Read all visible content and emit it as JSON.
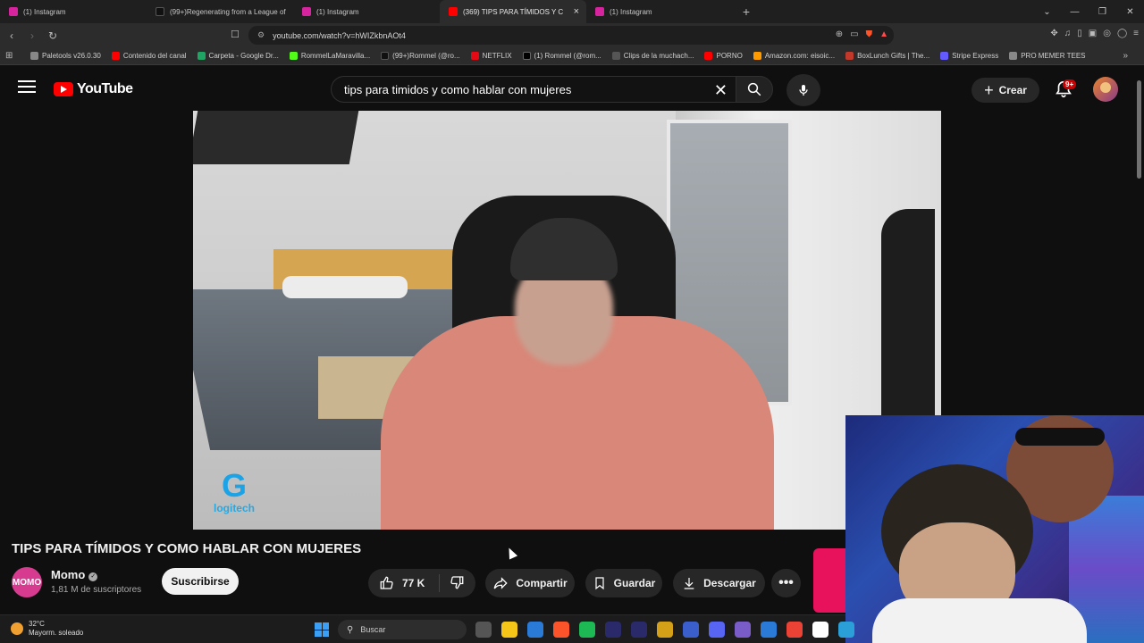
{
  "browser": {
    "tabs": [
      {
        "label": "(1) Instagram",
        "color": "#d6249f",
        "active": false
      },
      {
        "label": "(99+)Regenerating from a League of",
        "color": "#111111",
        "active": false
      },
      {
        "label": "(1) Instagram",
        "color": "#d6249f",
        "active": false
      },
      {
        "label": "(369) TIPS PARA TÍMIDOS Y C",
        "color": "#ff0000",
        "active": true
      },
      {
        "label": "(1) Instagram",
        "color": "#d6249f",
        "active": false
      }
    ],
    "url": "youtube.com/watch?v=hWIZkbnAOt4",
    "bookmarks": [
      {
        "label": "Paletools v26.0.30",
        "color": "#888888"
      },
      {
        "label": "Contenido del canal",
        "color": "#ff0000"
      },
      {
        "label": "Carpeta - Google Dr...",
        "color": "#1fa463"
      },
      {
        "label": "RommelLaMaravilla...",
        "color": "#53fc18"
      },
      {
        "label": "(99+)Rommel (@ro...",
        "color": "#111111"
      },
      {
        "label": "NETFLIX",
        "color": "#e50914"
      },
      {
        "label": "(1) Rommel (@rom...",
        "color": "#000000"
      },
      {
        "label": "Clips de la muchach...",
        "color": "#555555"
      },
      {
        "label": "PORNO",
        "color": "#ff0000"
      },
      {
        "label": "Amazon.com: eisoic...",
        "color": "#ff9900"
      },
      {
        "label": "BoxLunch Gifts | The...",
        "color": "#c0392b"
      },
      {
        "label": "Stripe Express",
        "color": "#635bff"
      },
      {
        "label": "PRO MEMER TEES",
        "color": "#888888"
      }
    ]
  },
  "youtube": {
    "logo_text": "YouTube",
    "search_query": "tips para timidos y como hablar  con mujeres",
    "create_label": "Crear",
    "notifications_badge": "9+",
    "video_watermark": "logitech",
    "video_title": "TIPS PARA TÍMIDOS Y COMO HABLAR CON MUJERES",
    "channel": {
      "name": "Momo",
      "subscribers": "1,81 M de suscriptores",
      "avatar_text": "MOMO"
    },
    "subscribe_label": "Suscribirse",
    "actions": {
      "likes": "77 K",
      "share": "Compartir",
      "save": "Guardar",
      "download": "Descargar"
    }
  },
  "taskbar": {
    "temperature": "32°C",
    "weather": "Mayorm. soleado",
    "search_placeholder": "Buscar",
    "apps": [
      "#555555",
      "#f5c518",
      "#2a7bd8",
      "#fb542b",
      "#1db954",
      "#2a2a6a",
      "#2a2a6a",
      "#d4a017",
      "#3a5fcc",
      "#5865f2",
      "#7a5cc8",
      "#2a7bd8",
      "#ea4335",
      "#ffffff",
      "#2a9fd8"
    ]
  }
}
